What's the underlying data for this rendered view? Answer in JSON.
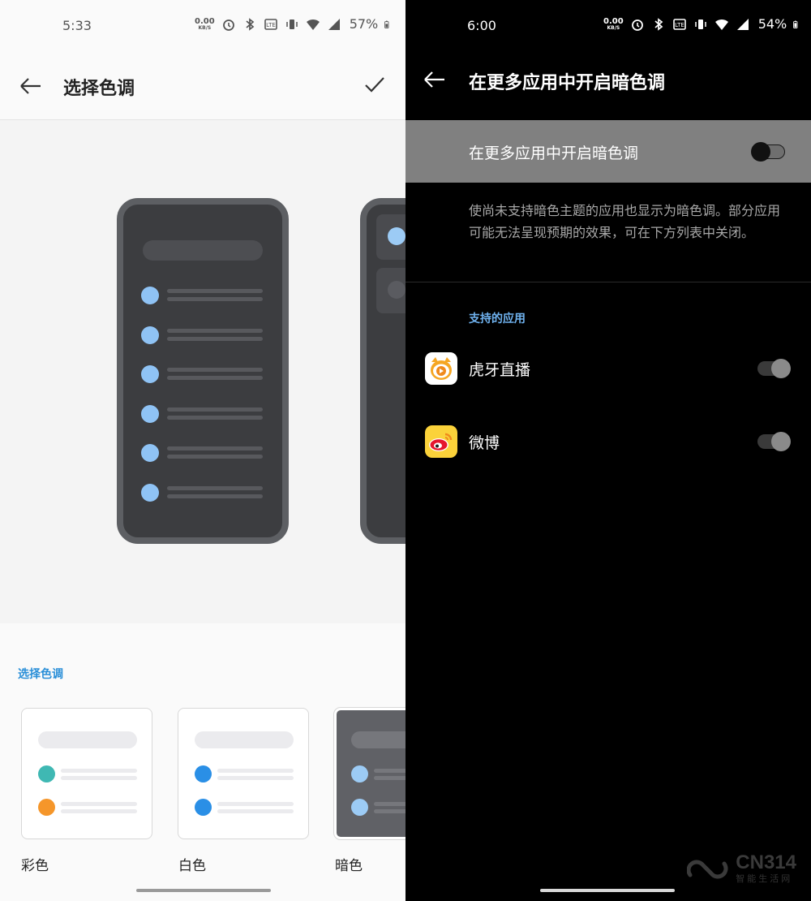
{
  "left": {
    "status": {
      "time": "5:33",
      "speed_value": "0.00",
      "speed_unit": "KB/S",
      "battery": "57%"
    },
    "title": "选择色调",
    "section_title": "选择色调",
    "themes": [
      {
        "label": "彩色",
        "dot_colors": [
          "#3fb8b3",
          "#f5962a"
        ]
      },
      {
        "label": "白色",
        "dot_colors": [
          "#2a8fe6",
          "#2a8fe6"
        ]
      },
      {
        "label": "暗色",
        "dot_colors": [
          "#9ccbf5",
          "#9ccbf5"
        ]
      }
    ],
    "accent": "#2a8fd8"
  },
  "right": {
    "status": {
      "time": "6:00",
      "speed_value": "0.00",
      "speed_unit": "KB/S",
      "battery": "54%"
    },
    "title": "在更多应用中开启暗色调",
    "master_toggle": {
      "label": "在更多应用中开启暗色调",
      "on": false
    },
    "description": "使尚未支持暗色主题的应用也显示为暗色调。部分应用可能无法呈现预期的效果，可在下方列表中关闭。",
    "supported_title": "支持的应用",
    "apps": [
      {
        "name": "虎牙直播",
        "icon": "huya-icon",
        "on": false
      },
      {
        "name": "微博",
        "icon": "weibo-icon",
        "on": false
      }
    ],
    "accent": "#6fb2ef"
  },
  "watermark": {
    "text": "CN314",
    "sub": "智能生活网"
  }
}
